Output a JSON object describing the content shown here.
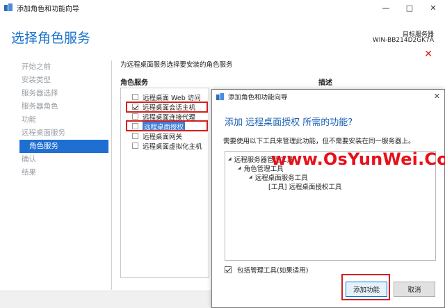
{
  "window": {
    "title": "添加角色和功能向导"
  },
  "header": {
    "title": "选择角色服务",
    "target_label": "目标服务器",
    "target_name": "WIN-BB214D2GK7A"
  },
  "nav": {
    "items": [
      {
        "label": "开始之前",
        "active": false
      },
      {
        "label": "安装类型",
        "active": false
      },
      {
        "label": "服务器选择",
        "active": false
      },
      {
        "label": "服务器角色",
        "active": false
      },
      {
        "label": "功能",
        "active": false
      },
      {
        "label": "远程桌面服务",
        "active": false
      },
      {
        "label": "角色服务",
        "active": true
      },
      {
        "label": "确认",
        "active": false
      },
      {
        "label": "结果",
        "active": false
      }
    ]
  },
  "main": {
    "instruction": "为远程桌面服务选择要安装的角色服务",
    "roles_header": "角色服务",
    "desc_header": "描述",
    "roles": [
      {
        "label": "远程桌面 Web 访问",
        "checked": false,
        "selected": false
      },
      {
        "label": "远程桌面会话主机",
        "checked": true,
        "selected": false
      },
      {
        "label": "远程桌面连接代理",
        "checked": false,
        "selected": false
      },
      {
        "label": "远程桌面授权",
        "checked": false,
        "selected": true
      },
      {
        "label": "远程桌面网关",
        "checked": false,
        "selected": false
      },
      {
        "label": "远程桌面虚拟化主机",
        "checked": false,
        "selected": false
      }
    ]
  },
  "dialog": {
    "title": "添加角色和功能向导",
    "heading": "添加 远程桌面授权 所需的功能?",
    "description": "需要使用以下工具来管理此功能，但不需要安装在同一服务器上。",
    "tree": [
      {
        "label": "远程服务器管理工具",
        "level": 0
      },
      {
        "label": "角色管理工具",
        "level": 1
      },
      {
        "label": "远程桌面服务工具",
        "level": 2
      },
      {
        "label": "[工具] 远程桌面授权工具",
        "level": 3
      }
    ],
    "include_tools_label": "包括管理工具(如果适用)",
    "include_tools_checked": true,
    "add_button": "添加功能",
    "cancel_button": "取消"
  },
  "watermark": "www.OsYunWei.Com",
  "colors": {
    "accent": "#1e6fd1",
    "highlight_border": "#d42020",
    "watermark": "#e8101a"
  }
}
